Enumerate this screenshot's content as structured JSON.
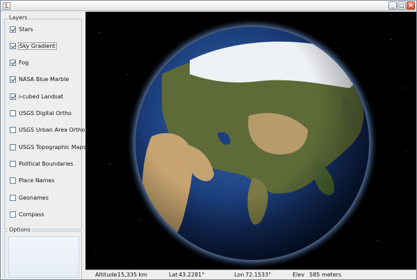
{
  "window": {
    "controls": {
      "minimize": "_",
      "maximize": "□",
      "close": "×"
    }
  },
  "layers_panel": {
    "title": "Layers",
    "items": [
      {
        "label": "Stars",
        "checked": true
      },
      {
        "label": "Sky Gradient",
        "checked": true,
        "focused": true
      },
      {
        "label": "Fog",
        "checked": true
      },
      {
        "label": "NASA Blue Marble",
        "checked": true
      },
      {
        "label": "i-cubed Landsat",
        "checked": true
      },
      {
        "label": "USGS Digital Ortho",
        "checked": false
      },
      {
        "label": "USGS Urban Area Ortho",
        "checked": false
      },
      {
        "label": "USGS Topographic Maps",
        "checked": false
      },
      {
        "label": "Political Boundaries",
        "checked": false
      },
      {
        "label": "Place Names",
        "checked": false
      },
      {
        "label": "Geonames",
        "checked": false
      },
      {
        "label": "Compass",
        "checked": false
      }
    ]
  },
  "options_panel": {
    "title": "Options"
  },
  "globe": {
    "colors": {
      "space": "#000000",
      "ocean": "#1d3f7a",
      "land": "#6b6a3a",
      "desert": "#c9a66b",
      "ice": "#f2f4f6"
    }
  },
  "status_bar": {
    "altitude_label": "Altitude",
    "altitude_value": "15,335 km",
    "lat_label": "Lat",
    "lat_value": "43.2281°",
    "lon_label": "Lon",
    "lon_value": "72.1533°",
    "elev_label": "Elev",
    "elev_value": "585 meters"
  }
}
